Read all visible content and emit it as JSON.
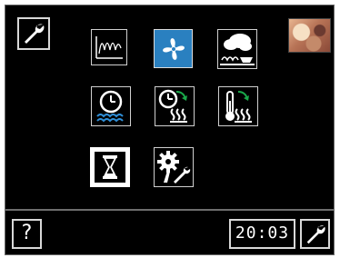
{
  "top_bar": {
    "settings_icon": "wrench-icon",
    "photo": "kitchen-photo"
  },
  "icons": [
    {
      "name": "heating-curve-icon"
    },
    {
      "name": "fan-icon",
      "color": "#2a80c0"
    },
    {
      "name": "steam-cooking-icon"
    },
    {
      "name": "timer-water-icon"
    },
    {
      "name": "timer-heat-icon"
    },
    {
      "name": "temperature-heat-icon"
    },
    {
      "name": "hourglass-icon"
    },
    {
      "name": "gear-tools-icon"
    }
  ],
  "footer": {
    "help_label": "?",
    "clock_hours": "20",
    "clock_sep": ":",
    "clock_minutes": "03",
    "settings_icon": "wrench-icon"
  },
  "colors": {
    "background": "#000000",
    "tile_border": "#d0d0d0",
    "fan_tile": "#2a80c0",
    "water_waves": "#2f8fd8",
    "arrow_green": "#1aa84a"
  }
}
